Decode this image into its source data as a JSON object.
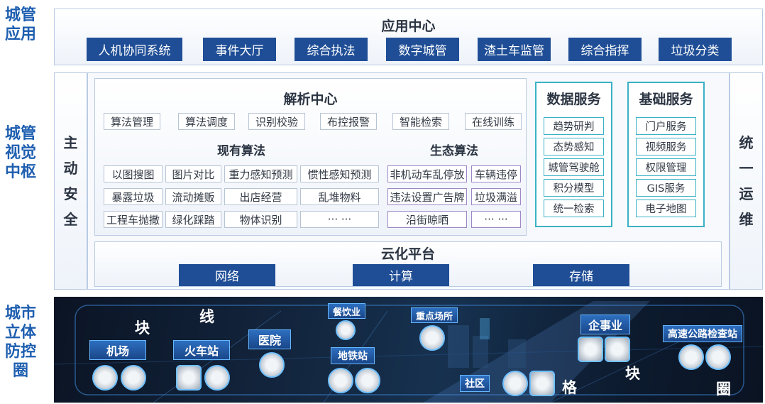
{
  "side_labels": {
    "app": "城管应用",
    "hub": "城管视觉中枢",
    "defense": "城市立体防控圈"
  },
  "app_center": {
    "title": "应用中心",
    "items": [
      "人机协同系统",
      "事件大厅",
      "综合执法",
      "数字城管",
      "渣土车监管",
      "综合指挥",
      "垃圾分类"
    ]
  },
  "analysis_center": {
    "title": "解析中心",
    "tools": [
      "算法管理",
      "算法调度",
      "识别校验",
      "布控报警",
      "智能检索",
      "在线训练"
    ],
    "existing_title": "现有算法",
    "existing_rows": [
      [
        "以图搜图",
        "图片对比",
        "重力感知预测",
        "惯性感知预测"
      ],
      [
        "暴露垃圾",
        "流动摊贩",
        "出店经营",
        "乱堆物料"
      ],
      [
        "工程车抛撒",
        "绿化踩踏",
        "物体识别",
        "··· ···"
      ]
    ],
    "eco_title": "生态算法",
    "eco_rows": [
      [
        "非机动车乱停放",
        "车辆违停"
      ],
      [
        "违法设置广告牌",
        "垃圾满溢"
      ],
      [
        "沿街晾晒",
        "··· ···"
      ]
    ]
  },
  "data_services": {
    "title": "数据服务",
    "items": [
      "趋势研判",
      "态势感知",
      "城管驾驶舱",
      "积分模型",
      "统一检索"
    ]
  },
  "base_services": {
    "title": "基础服务",
    "items": [
      "门户服务",
      "视频服务",
      "权限管理",
      "GIS服务",
      "电子地图"
    ]
  },
  "left_column": {
    "chars": [
      "主",
      "动",
      "安",
      "全"
    ]
  },
  "right_column": {
    "chars": [
      "统",
      "一",
      "运",
      "维"
    ]
  },
  "cloud": {
    "title": "云化平台",
    "items": [
      "网络",
      "计算",
      "存储"
    ]
  },
  "defense_map": {
    "locations": [
      "机场",
      "火车站",
      "医院",
      "餐饮业",
      "地铁站",
      "重点场所",
      "企事业",
      "社区",
      "高速公路检查站"
    ],
    "grid_words": [
      "块",
      "线",
      "格",
      "块",
      "圈"
    ]
  },
  "colors": {
    "brand_blue": "#1f5fb0",
    "button_blue": "#1f4e96",
    "teal": "#3bb1c5",
    "purple": "#9d87c7"
  }
}
